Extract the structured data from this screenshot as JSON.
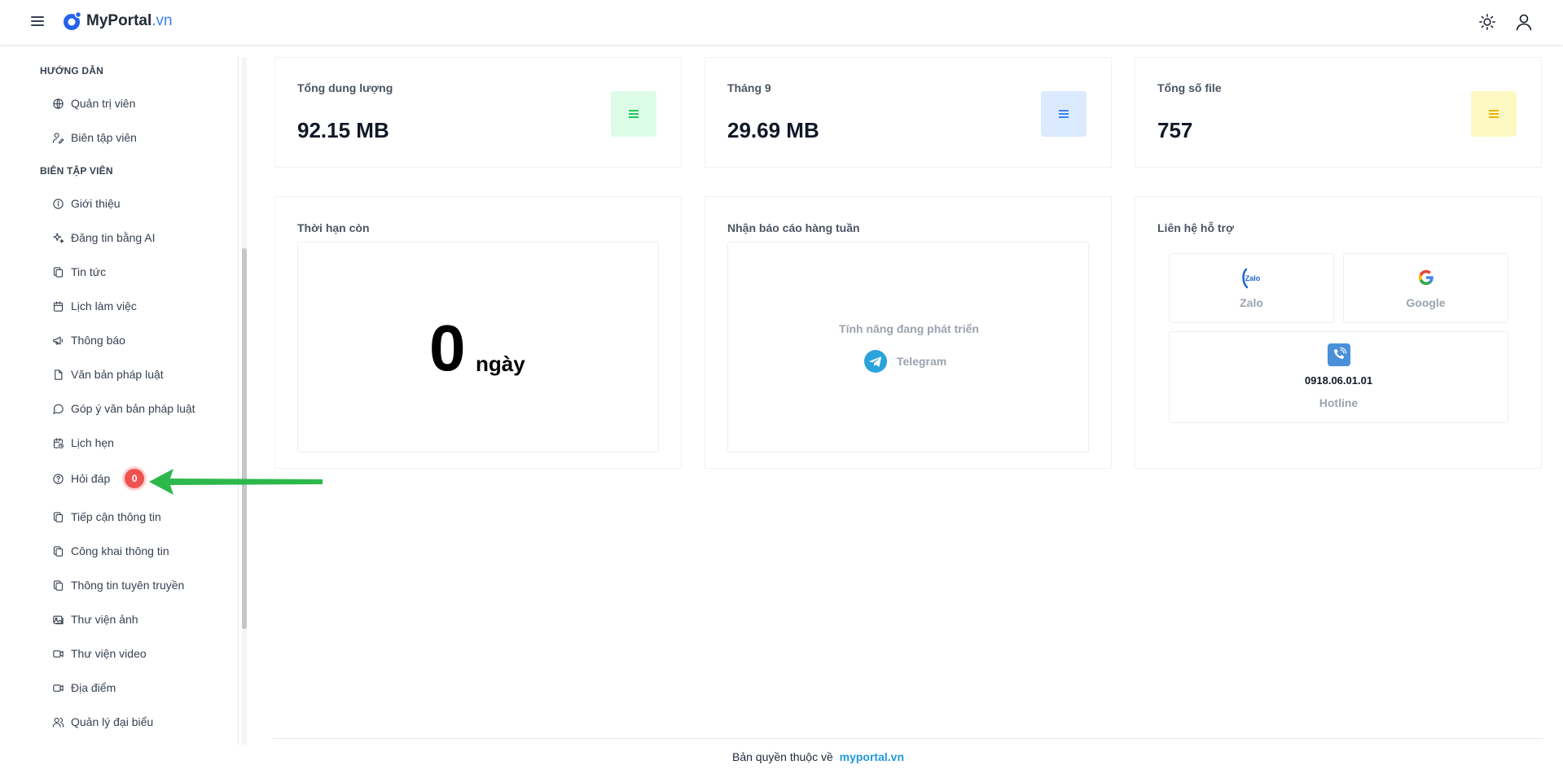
{
  "header": {
    "logo_name": "MyPortal",
    "logo_tld": ".vn",
    "menu_icon": "hamburger-icon",
    "theme_icon": "sun-icon",
    "user_icon": "user-icon"
  },
  "sidebar": {
    "sections": [
      {
        "title": "HƯỚNG DẪN",
        "items": [
          {
            "label": "Quản trị viên",
            "icon": "globe-icon"
          },
          {
            "label": "Biên tập viên",
            "icon": "user-edit-icon"
          }
        ]
      },
      {
        "title": "BIÊN TẬP VIÊN",
        "items": [
          {
            "label": "Giới thiệu",
            "icon": "info-icon"
          },
          {
            "label": "Đăng tin bằng AI",
            "icon": "sparkles-icon"
          },
          {
            "label": "Tin tức",
            "icon": "copy-icon"
          },
          {
            "label": "Lịch làm việc",
            "icon": "calendar-icon"
          },
          {
            "label": "Thông báo",
            "icon": "megaphone-icon"
          },
          {
            "label": "Văn bản pháp luật",
            "icon": "file-icon"
          },
          {
            "label": "Góp ý văn bản pháp luật",
            "icon": "message-icon"
          },
          {
            "label": "Lịch hẹn",
            "icon": "calendar-clock-icon"
          },
          {
            "label": "Hỏi đáp",
            "icon": "help-circle-icon",
            "badge": "0"
          },
          {
            "label": "Tiếp cận thông tin",
            "icon": "copy-icon"
          },
          {
            "label": "Công khai thông tin",
            "icon": "copy-icon"
          },
          {
            "label": "Thông tin tuyên truyền",
            "icon": "copy-icon"
          },
          {
            "label": "Thư viện ảnh",
            "icon": "images-icon"
          },
          {
            "label": "Thư viện video",
            "icon": "video-icon"
          },
          {
            "label": "Địa điểm",
            "icon": "video-icon"
          },
          {
            "label": "Quản lý đại biểu",
            "icon": "users-icon"
          }
        ]
      }
    ]
  },
  "stats": [
    {
      "label": "Tổng dung lượng",
      "value": "92.15 MB",
      "color": "#dcfce7",
      "icon_color": "#22c55e",
      "icon": "list-icon"
    },
    {
      "label": "Tháng 9",
      "value": "29.69 MB",
      "color": "#dbeafe",
      "icon_color": "#3b82f6",
      "icon": "list-icon"
    },
    {
      "label": "Tổng số file",
      "value": "757",
      "color": "#fef9c3",
      "icon_color": "#eab308",
      "icon": "list-icon"
    }
  ],
  "panels": {
    "remaining": {
      "title": "Thời hạn còn",
      "value": "0",
      "unit": "ngày"
    },
    "weekly": {
      "title": "Nhận báo cáo hàng tuần",
      "dev_text": "Tính năng đang phát triển",
      "telegram_label": "Telegram"
    },
    "support": {
      "title": "Liên hệ hỗ trợ",
      "zalo_label": "Zalo",
      "zalo_logo_text": "Zalo",
      "google_label": "Google",
      "hotline_number": "0918.06.01.01",
      "hotline_label": "Hotline"
    }
  },
  "footer": {
    "text": "Bản quyền thuộc về",
    "link": "myportal.vn"
  }
}
